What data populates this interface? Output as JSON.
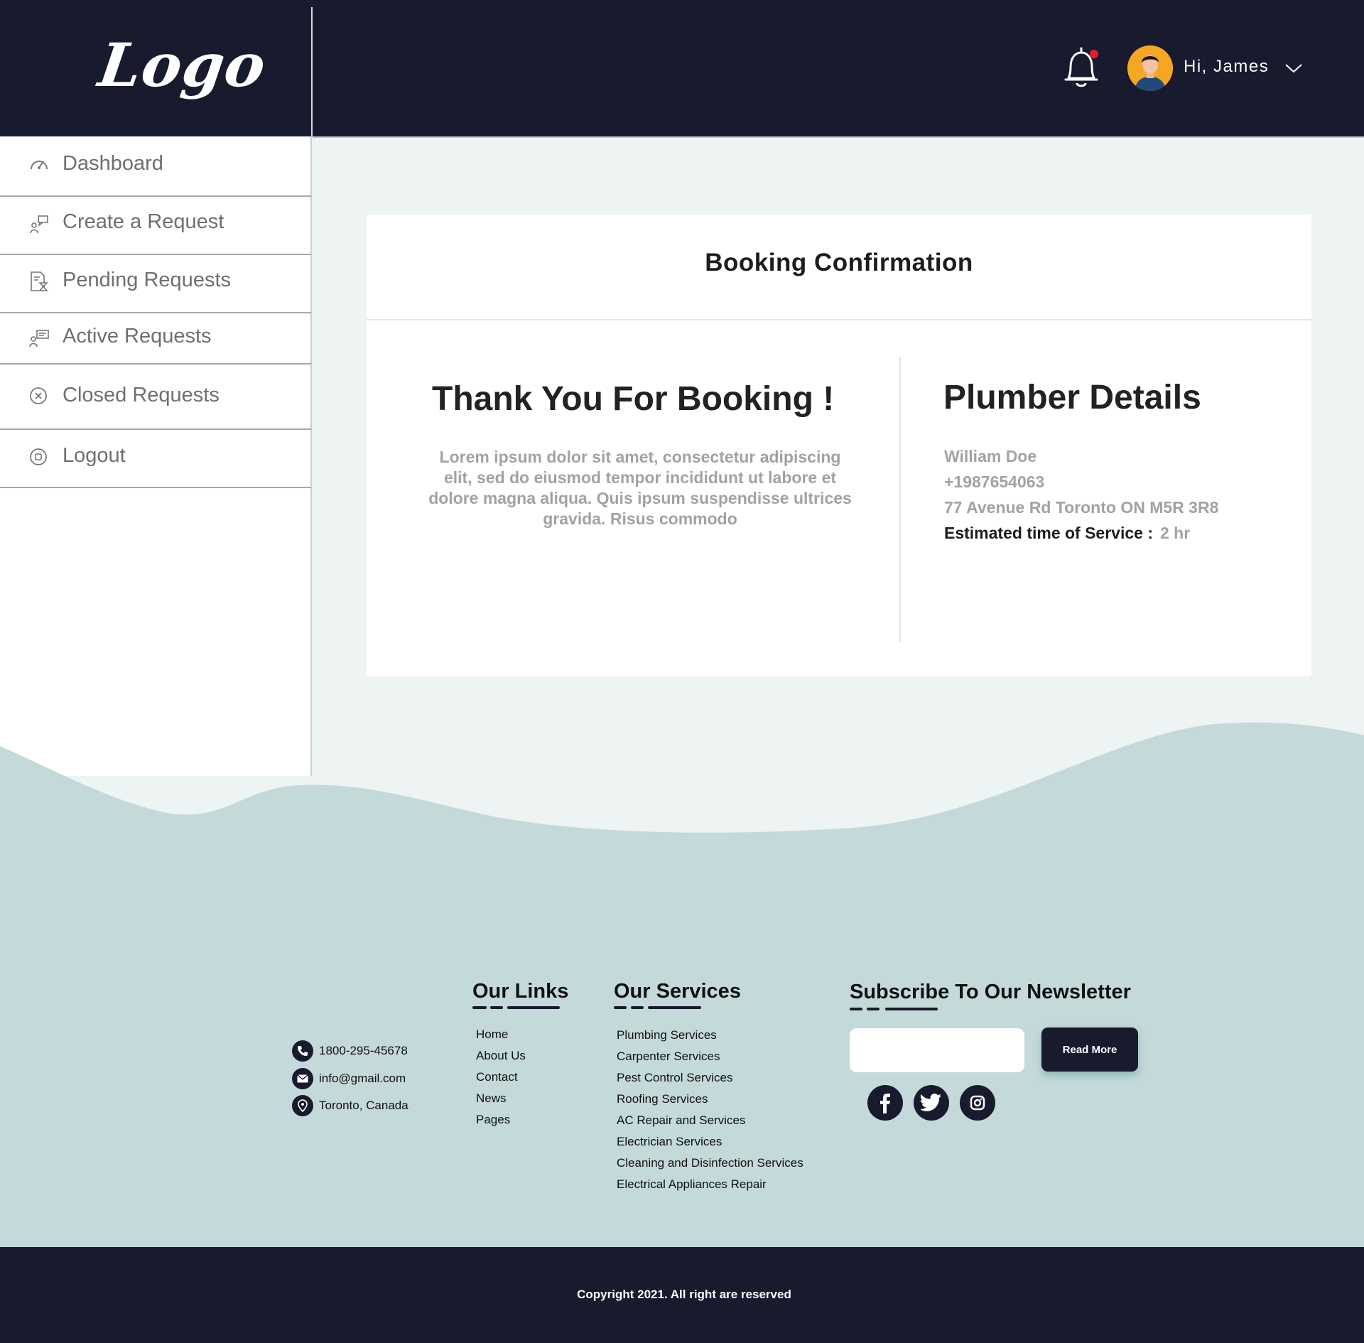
{
  "header": {
    "logo": "Logo",
    "greeting": "Hi, James"
  },
  "sidebar": {
    "items": [
      {
        "label": "Dashboard"
      },
      {
        "label": "Create a Request"
      },
      {
        "label": "Pending Requests"
      },
      {
        "label": "Active Requests"
      },
      {
        "label": "Closed Requests"
      },
      {
        "label": "Logout"
      }
    ]
  },
  "card": {
    "title": "Booking Confirmation",
    "thanks": "Thank You For Booking !",
    "body": "Lorem ipsum dolor sit amet, consectetur adipiscing elit, sed do eiusmod tempor incididunt ut labore et dolore magna aliqua. Quis ipsum suspendisse ultrices gravida. Risus commodo",
    "plumber_title": "Plumber Details",
    "plumber_name": "William Doe",
    "plumber_phone": "+1987654063",
    "plumber_address": "77 Avenue Rd Toronto ON M5R 3R8",
    "estimate_label": "Estimated time of Service :",
    "estimate_value": "2 hr"
  },
  "footer": {
    "contact": {
      "phone": "1800-295-45678",
      "email": "info@gmail.com",
      "location": "Toronto, Canada"
    },
    "links_title": "Our Links",
    "links": [
      "Home",
      "About Us",
      "Contact",
      "News",
      "Pages"
    ],
    "services_title": "Our Services",
    "services": [
      "Plumbing Services",
      "Carpenter Services",
      "Pest Control Services",
      "Roofing Services",
      "AC Repair and Services",
      "Electrician Services",
      "Cleaning and Disinfection Services",
      "Electrical Appliances Repair"
    ],
    "newsletter_title": "Subscribe To Our Newsletter",
    "newsletter_placeholder": "",
    "read_more": "Read More",
    "social_icons": [
      "facebook-icon",
      "twitter-icon",
      "instagram-icon"
    ],
    "copyright": "Copyright 2021. All right are reserved"
  },
  "colors": {
    "navy": "#181a2e",
    "footer_bg": "#c4d9d9",
    "content_bg": "#eef3f3",
    "notification_dot": "#e0212c",
    "avatar_bg": "#f5a623"
  }
}
